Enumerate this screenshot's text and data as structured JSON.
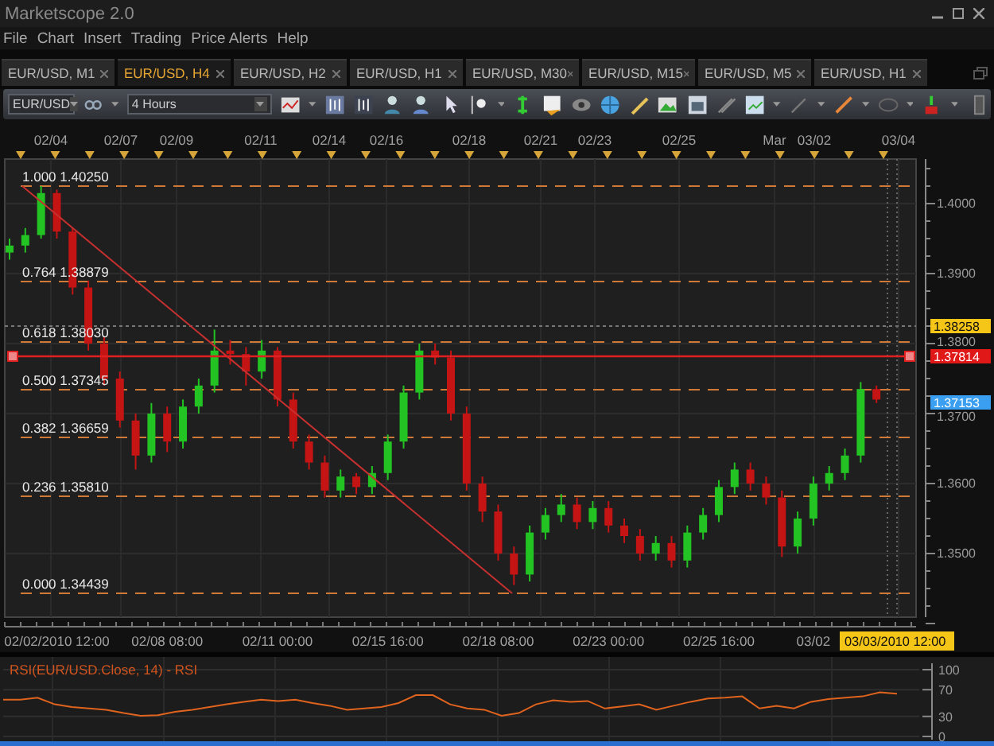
{
  "window": {
    "title": "Marketscope 2.0"
  },
  "menu": [
    "File",
    "Chart",
    "Insert",
    "Trading",
    "Price Alerts",
    "Help"
  ],
  "tabs": [
    {
      "label": "EUR/USD, M1",
      "selected": false
    },
    {
      "label": "EUR/USD, H4",
      "selected": true
    },
    {
      "label": "EUR/USD, H2",
      "selected": false
    },
    {
      "label": "EUR/USD, H1",
      "selected": false
    },
    {
      "label": "EUR/USD, M30",
      "selected": false
    },
    {
      "label": "EUR/USD, M15",
      "selected": false
    },
    {
      "label": "EUR/USD, M5",
      "selected": false
    },
    {
      "label": "EUR/USD, H1",
      "selected": false
    }
  ],
  "toolbar": {
    "symbol": "EUR/USD",
    "timeframe": "4 Hours"
  },
  "chart": {
    "top_axis": [
      "02/04",
      "02/07",
      "02/09",
      "02/11",
      "02/14",
      "02/16",
      "02/18",
      "02/21",
      "02/23",
      "02/25",
      "Mar",
      "03/02",
      "03/04"
    ],
    "fibonacci": [
      {
        "ratio": "1.000",
        "price": "1.40250"
      },
      {
        "ratio": "0.764",
        "price": "1.38879"
      },
      {
        "ratio": "0.618",
        "price": "1.38030"
      },
      {
        "ratio": "0.500",
        "price": "1.37345"
      },
      {
        "ratio": "0.382",
        "price": "1.36659"
      },
      {
        "ratio": "0.236",
        "price": "1.35810"
      },
      {
        "ratio": "0.000",
        "price": "1.34439"
      }
    ],
    "chart_data": {
      "type": "candlestick",
      "ylim": [
        1.34091,
        1.40636
      ],
      "yticks": [
        {
          "value": 1.4,
          "label": "1.4000"
        },
        {
          "value": 1.39,
          "label": "1.3900"
        },
        {
          "value": 1.38,
          "label": "1.3800"
        },
        {
          "value": 1.37,
          "label": "1.3700"
        },
        {
          "value": 1.36,
          "label": "1.3600"
        },
        {
          "value": 1.35,
          "label": "1.3500"
        }
      ],
      "categories": [
        null,
        null,
        null,
        "02/02/2010 12:00",
        null,
        null,
        null,
        null,
        null,
        null,
        "02/08 08:00",
        null,
        null,
        null,
        null,
        null,
        null,
        "02/11 00:00",
        null,
        null,
        null,
        null,
        null,
        null,
        "02/15 16:00",
        null,
        null,
        null,
        null,
        null,
        null,
        "02/18 08:00",
        null,
        null,
        null,
        null,
        null,
        null,
        "02/23 00:00",
        null,
        null,
        null,
        null,
        null,
        null,
        "02/25 16:00",
        null,
        null,
        null,
        null,
        null,
        "03/02",
        null,
        null,
        null,
        null
      ],
      "ohlc": [
        [
          1.393,
          1.395,
          1.392,
          1.394
        ],
        [
          1.394,
          1.3965,
          1.393,
          1.3955
        ],
        [
          1.3955,
          1.4025,
          1.395,
          1.4015
        ],
        [
          1.4015,
          1.402,
          1.395,
          1.396
        ],
        [
          1.396,
          1.3965,
          1.387,
          1.388
        ],
        [
          1.388,
          1.389,
          1.379,
          1.38
        ],
        [
          1.38,
          1.381,
          1.374,
          1.375
        ],
        [
          1.375,
          1.376,
          1.368,
          1.369
        ],
        [
          1.369,
          1.37,
          1.362,
          1.364
        ],
        [
          1.364,
          1.3715,
          1.363,
          1.37
        ],
        [
          1.37,
          1.371,
          1.3645,
          1.366
        ],
        [
          1.366,
          1.372,
          1.365,
          1.371
        ],
        [
          1.371,
          1.375,
          1.37,
          1.374
        ],
        [
          1.374,
          1.382,
          1.373,
          1.379
        ],
        [
          1.379,
          1.3805,
          1.377,
          1.3785
        ],
        [
          1.3785,
          1.3795,
          1.374,
          1.376
        ],
        [
          1.376,
          1.3805,
          1.375,
          1.379
        ],
        [
          1.379,
          1.3795,
          1.371,
          1.372
        ],
        [
          1.372,
          1.373,
          1.365,
          1.366
        ],
        [
          1.366,
          1.367,
          1.362,
          1.363
        ],
        [
          1.363,
          1.364,
          1.358,
          1.359
        ],
        [
          1.359,
          1.362,
          1.358,
          1.361
        ],
        [
          1.361,
          1.3615,
          1.3585,
          1.3595
        ],
        [
          1.3595,
          1.3625,
          1.3585,
          1.3615
        ],
        [
          1.3615,
          1.367,
          1.3605,
          1.366
        ],
        [
          1.366,
          1.374,
          1.365,
          1.373
        ],
        [
          1.373,
          1.38,
          1.372,
          1.379
        ],
        [
          1.379,
          1.38,
          1.377,
          1.378
        ],
        [
          1.378,
          1.379,
          1.369,
          1.37
        ],
        [
          1.37,
          1.371,
          1.359,
          1.36
        ],
        [
          1.36,
          1.361,
          1.3545,
          1.356
        ],
        [
          1.356,
          1.357,
          1.349,
          1.35
        ],
        [
          1.35,
          1.351,
          1.3455,
          1.347
        ],
        [
          1.347,
          1.354,
          1.346,
          1.353
        ],
        [
          1.353,
          1.3565,
          1.352,
          1.3555
        ],
        [
          1.3555,
          1.3585,
          1.3545,
          1.357
        ],
        [
          1.357,
          1.358,
          1.3535,
          1.3545
        ],
        [
          1.3545,
          1.3575,
          1.3535,
          1.3565
        ],
        [
          1.3565,
          1.3575,
          1.353,
          1.354
        ],
        [
          1.354,
          1.355,
          1.3515,
          1.3525
        ],
        [
          1.3525,
          1.3535,
          1.349,
          1.35
        ],
        [
          1.35,
          1.3525,
          1.349,
          1.3515
        ],
        [
          1.3515,
          1.3525,
          1.348,
          1.349
        ],
        [
          1.349,
          1.354,
          1.348,
          1.353
        ],
        [
          1.353,
          1.3565,
          1.352,
          1.3555
        ],
        [
          1.3555,
          1.3605,
          1.3545,
          1.3595
        ],
        [
          1.3595,
          1.363,
          1.3585,
          1.362
        ],
        [
          1.362,
          1.363,
          1.359,
          1.36
        ],
        [
          1.36,
          1.361,
          1.357,
          1.358
        ],
        [
          1.358,
          1.359,
          1.3495,
          1.351
        ],
        [
          1.351,
          1.356,
          1.35,
          1.355
        ],
        [
          1.355,
          1.361,
          1.354,
          1.36
        ],
        [
          1.36,
          1.3625,
          1.359,
          1.3615
        ],
        [
          1.3615,
          1.365,
          1.3605,
          1.364
        ],
        [
          1.364,
          1.3745,
          1.363,
          1.3735
        ],
        [
          1.3735,
          1.374,
          1.3715,
          1.372
        ]
      ]
    },
    "price_tags": [
      {
        "value": "1.38258",
        "color": "#f5c518"
      },
      {
        "value": "1.37814",
        "color": "#e01818"
      },
      {
        "value": "1.37153",
        "color": "#3a9ff0"
      }
    ],
    "cursor_time": "03/03/2010 12:00"
  },
  "rsi": {
    "title": "RSI(EUR/USD.Close, 14) - RSI",
    "chart_data": {
      "type": "line",
      "ylim": [
        0,
        100
      ],
      "yticks": [
        0,
        30,
        70,
        100
      ],
      "grid": true,
      "series": [
        {
          "color": "#e0631e",
          "values": [
            55,
            55,
            58,
            48,
            44,
            42,
            40,
            35,
            31,
            32,
            37,
            40,
            44,
            48,
            52,
            55,
            53,
            55,
            50,
            46,
            40,
            42,
            44,
            50,
            62,
            62,
            48,
            42,
            40,
            31,
            35,
            48,
            54,
            52,
            53,
            42,
            45,
            48,
            40,
            46,
            52,
            57,
            58,
            60,
            42,
            46,
            42,
            52,
            56,
            58,
            60,
            66,
            64
          ]
        }
      ]
    }
  }
}
